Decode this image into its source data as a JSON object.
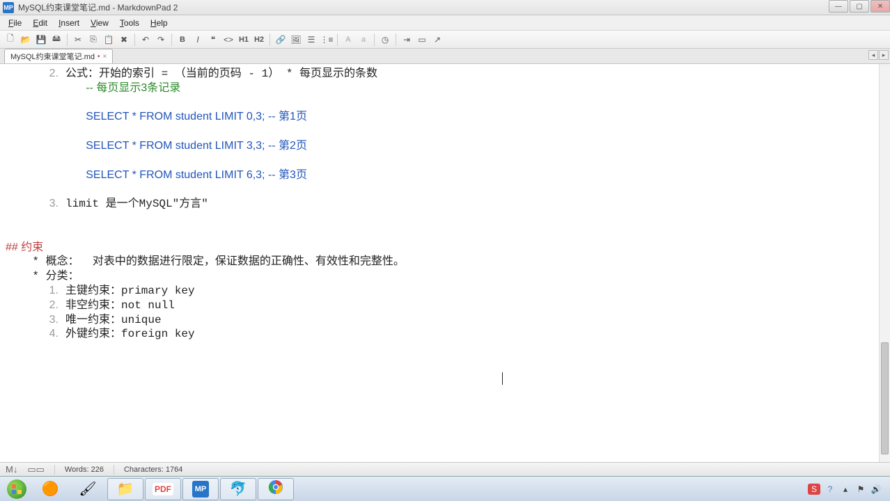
{
  "window": {
    "app_icon": "MP",
    "title": "MySQL约束课堂笔记.md - MarkdownPad 2"
  },
  "menu": {
    "file": "File",
    "edit": "Edit",
    "insert": "Insert",
    "view": "View",
    "tools": "Tools",
    "help": "Help"
  },
  "toolbar": {
    "h1": "H1",
    "h2": "H2",
    "bold": "B",
    "upper_a": "A",
    "lower_a": "a"
  },
  "tab": {
    "name": "MySQL约束课堂笔记.md",
    "modified": "•",
    "close": "×"
  },
  "editor": {
    "lines": [
      {
        "n": "2.",
        "cls": "ol-num",
        "text": "公式：开始的索引 = （当前的页码 - 1） * 每页显示的条数"
      },
      {
        "indent": "            ",
        "comment": "-- 每页显示3条记录"
      },
      {
        "blank": true
      },
      {
        "indent": "            ",
        "code": "SELECT * FROM student LIMIT 0,3; -- 第1页"
      },
      {
        "blank": true
      },
      {
        "indent": "            ",
        "code": "SELECT * FROM student LIMIT 3,3; -- 第2页"
      },
      {
        "blank": true
      },
      {
        "indent": "            ",
        "code": "SELECT * FROM student LIMIT 6,3; -- 第3页"
      },
      {
        "blank": true
      },
      {
        "n": "3.",
        "cls": "ol-num",
        "text": "limit 是一个MySQL\"方言\""
      },
      {
        "blank": true
      },
      {
        "blank": true
      },
      {
        "heading": "## 约束"
      },
      {
        "plain": "    * 概念：  对表中的数据进行限定，保证数据的正确性、有效性和完整性。"
      },
      {
        "plain": "    * 分类："
      },
      {
        "n": "1.",
        "cls": "ol-num",
        "text": "主键约束：primary key"
      },
      {
        "n": "2.",
        "cls": "ol-num",
        "text": "非空约束：not null"
      },
      {
        "n": "3.",
        "cls": "ol-num",
        "text": "唯一约束：unique"
      },
      {
        "n": "4.",
        "cls": "ol-num",
        "text": "外键约束：foreign key"
      }
    ]
  },
  "status": {
    "words_label": "Words:",
    "words": "226",
    "chars_label": "Characters:",
    "chars": "1764"
  },
  "taskbar": {
    "apps": [
      "media",
      "paint",
      "explorer",
      "pdf",
      "mp",
      "dolphin",
      "chrome"
    ]
  }
}
